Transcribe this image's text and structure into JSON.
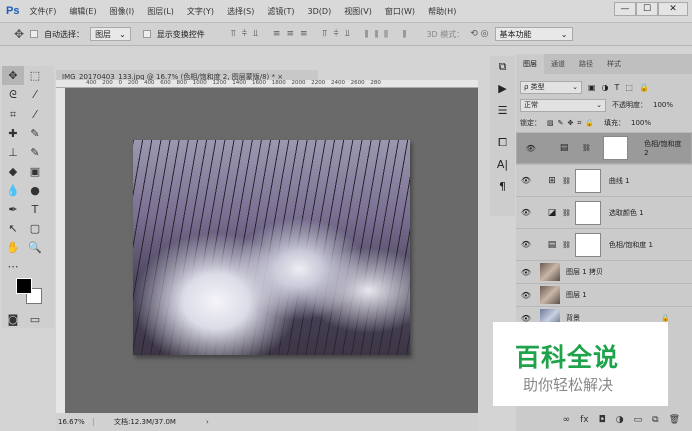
{
  "app": {
    "logo": "Ps",
    "menus": [
      "文件(F)",
      "编辑(E)",
      "图像(I)",
      "图层(L)",
      "文字(Y)",
      "选择(S)",
      "滤镜(T)",
      "3D(D)",
      "视图(V)",
      "窗口(W)",
      "帮助(H)"
    ],
    "win": [
      "—",
      "☐",
      "✕"
    ]
  },
  "options": {
    "auto_select": "自动选择：",
    "auto_select_value": "图层",
    "show_transform": "显示变换控件",
    "mode_3d": "3D 模式：",
    "workspace": "基本功能"
  },
  "document": {
    "tab": "IMG_20170403_133.jpg @ 16.7% (色相/饱和度 2, 图层蒙版/8) *",
    "close": "×",
    "ruler": "400  200  0    200  400  600  800  1000  1200  1400  1600  1800  2000  2200  2400  2600  280"
  },
  "status": {
    "zoom": "16.67%",
    "doc": "文档:12.3M/37.0M",
    "arrow": "›"
  },
  "panel": {
    "tabs": [
      "图层",
      "通道",
      "路径",
      "样式"
    ],
    "filter": "ρ 类型",
    "blend": "正常",
    "opacity_label": "不透明度：",
    "opacity": "100%",
    "lock_label": "锁定：",
    "fill_label": "填充：",
    "fill": "100%",
    "layers": [
      {
        "name": "色相/饱和度 2",
        "type": "adj",
        "icon": "▤",
        "selected": true
      },
      {
        "name": "曲线 1",
        "type": "adj",
        "icon": "⊞"
      },
      {
        "name": "选取颜色 1",
        "type": "adj",
        "icon": "◪"
      },
      {
        "name": "色相/饱和度 1",
        "type": "adj",
        "icon": "▤"
      },
      {
        "name": "图层 1 拷贝",
        "type": "img"
      },
      {
        "name": "图层 1",
        "type": "img"
      },
      {
        "name": "背景",
        "type": "bg",
        "lock": "🔒"
      }
    ]
  },
  "watermark": {
    "title": "百科全说",
    "subtitle": "助你轻松解决"
  }
}
